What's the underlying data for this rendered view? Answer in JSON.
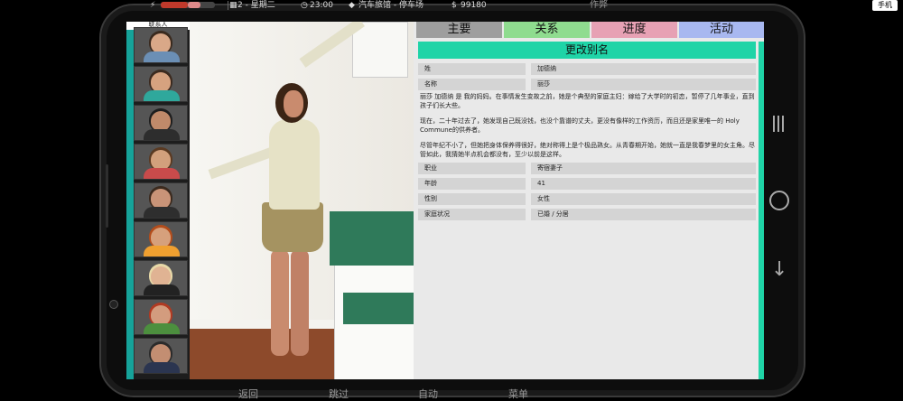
{
  "hud": {
    "day": "2 - 星期二",
    "time": "23:00",
    "location": "汽车旅馆 - 停车场",
    "money": "99180",
    "center_label": "作弊",
    "top_right": "手机",
    "health_color": "#c0392b",
    "energy_color": "#e08a8a"
  },
  "contacts": {
    "header": "联系人",
    "items": [
      {
        "tag": "",
        "skin": "#d9a888",
        "hair": "#3a2a1e",
        "shirt": "#6b8fb5"
      },
      {
        "tag": "",
        "skin": "#d6a27f",
        "hair": "#3b2a1f",
        "shirt": "#2fa89c"
      },
      {
        "tag": "",
        "skin": "#c08a6a",
        "hair": "#1e1e1e",
        "shirt": "#2d2d2d"
      },
      {
        "tag": "",
        "skin": "#d2a07c",
        "hair": "#5a3a22",
        "shirt": "#c94b4b"
      },
      {
        "tag": "",
        "skin": "#c99478",
        "hair": "#3b2a1e",
        "shirt": "#2e2e2e"
      },
      {
        "tag": "",
        "skin": "#d6a07c",
        "hair": "#b34d1c",
        "shirt": "#f0a030"
      },
      {
        "tag": "",
        "skin": "#e0b393",
        "hair": "#e8d9a8",
        "shirt": "#222"
      },
      {
        "tag": "",
        "skin": "#d39c7e",
        "hair": "#b13a22",
        "shirt": "#4c8f3e"
      },
      {
        "tag": "",
        "skin": "#c38e72",
        "hair": "#2b2b2b",
        "shirt": "#2b3550"
      }
    ]
  },
  "tabs": [
    "主要",
    "关系",
    "进度",
    "活动"
  ],
  "rename_label": "更改别名",
  "fields_top": [
    {
      "key": "姓",
      "value": "加德纳"
    },
    {
      "key": "名称",
      "value": "丽莎"
    }
  ],
  "bio": [
    "丽莎 加德纳 是 我的妈妈。在事情发生变故之前，她是个典型的家庭主妇：嫁给了大学时的初恋，暂停了几年事业，直到孩子们长大些。",
    "现在，二十年过去了，她发现自己既没钱，也没个靠谱的丈夫，更没有像样的工作资历，而且还是家里唯一的 Holy Commune的供养者。",
    "尽管年纪不小了，但她把身体保养得很好，绝对称得上是个极品熟女。从青春期开始，她就一直是我春梦里的女主角。尽管如此，我猜她半点机会都没有，至少以前是这样。"
  ],
  "fields_bottom": [
    {
      "key": "职业",
      "value": "寄宿妻子"
    },
    {
      "key": "年龄",
      "value": "41"
    },
    {
      "key": "性别",
      "value": "女性"
    },
    {
      "key": "家庭状况",
      "value": "已婚 / 分居"
    }
  ],
  "bottom_menu": [
    "返回",
    "跳过",
    "自动",
    "菜单"
  ]
}
